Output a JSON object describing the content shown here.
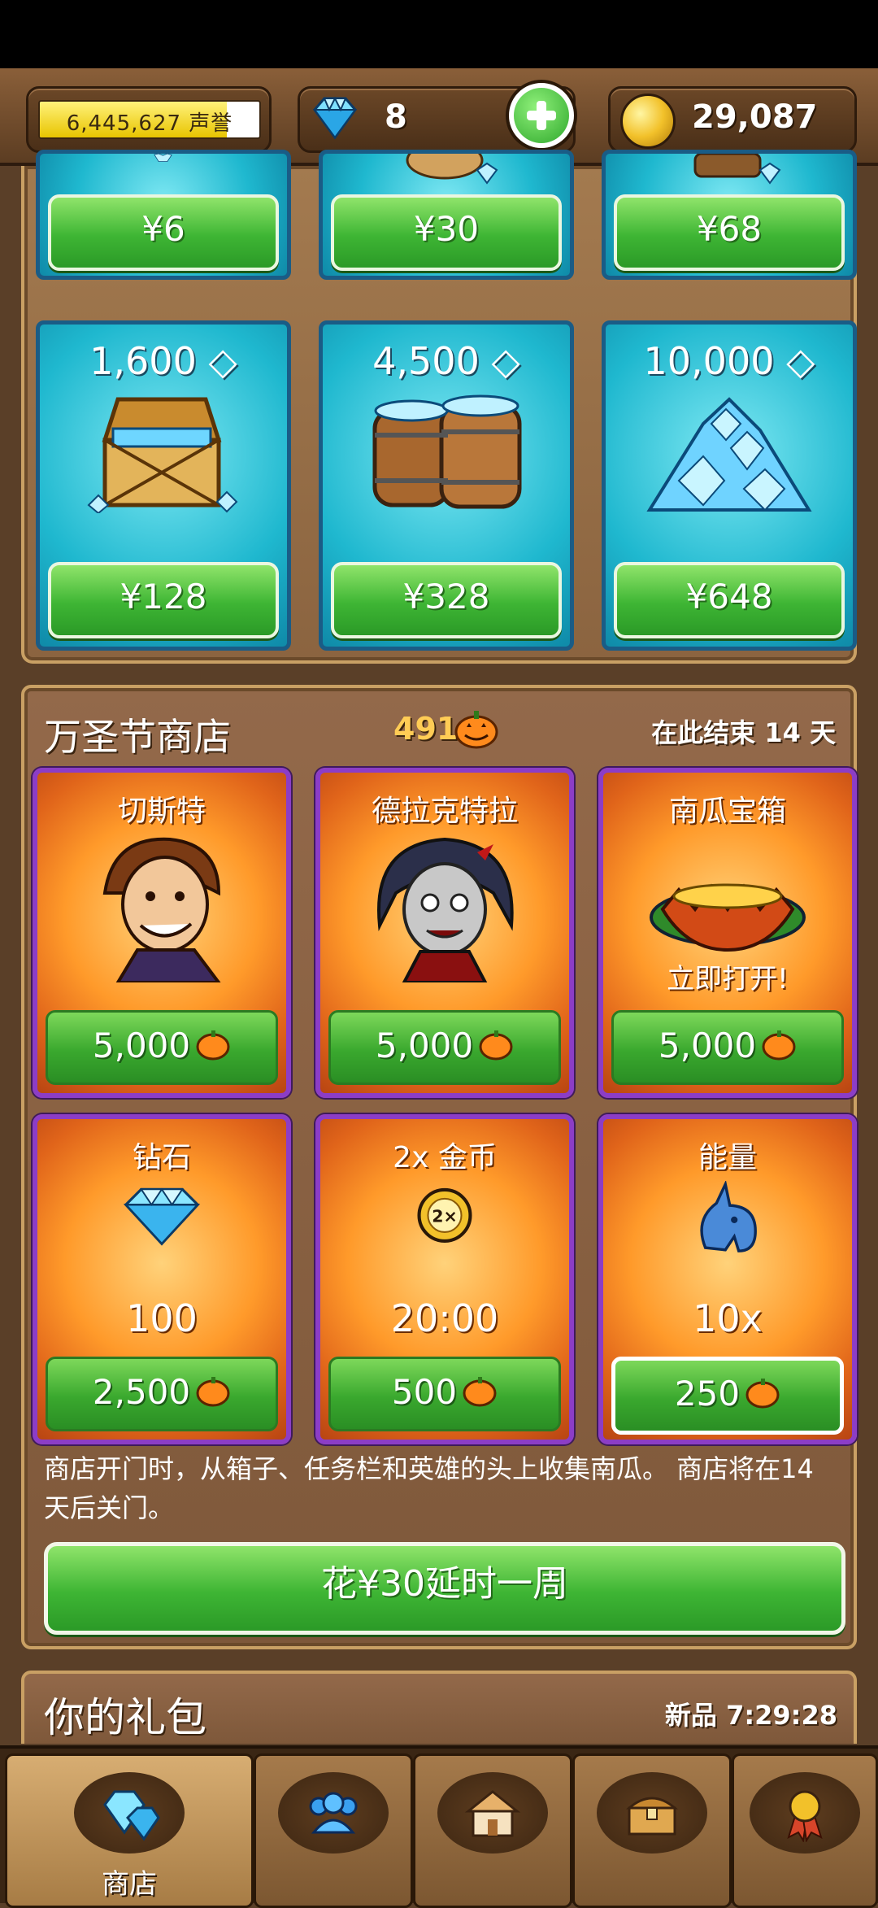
{
  "top_bar": {
    "reputation": "6,445,627 声誉",
    "reputation_fill": 0.85,
    "gems": "8",
    "coins": "29,087"
  },
  "gem_shop": {
    "top_row_prices": [
      "¥6",
      "¥30",
      "¥68"
    ],
    "packs": [
      {
        "amount": "1,600",
        "price": "¥128"
      },
      {
        "amount": "4,500",
        "price": "¥328"
      },
      {
        "amount": "10,000",
        "price": "¥648"
      }
    ]
  },
  "halloween": {
    "title": "万圣节商店",
    "pumpkins": "491",
    "ends": "在此结束 14 天",
    "items": [
      {
        "name": "切斯特",
        "sub": "",
        "price": "5,000"
      },
      {
        "name": "德拉克特拉",
        "sub": "",
        "price": "5,000"
      },
      {
        "name": "南瓜宝箱",
        "sub": "立即打开!",
        "price": "5,000"
      },
      {
        "name": "钻石",
        "sub": "100",
        "price": "2,500"
      },
      {
        "name": "2x 金币",
        "sub": "20:00",
        "price": "500"
      },
      {
        "name": "能量",
        "sub": "10x",
        "price": "250"
      }
    ],
    "description": "商店开门时，从箱子、任务栏和英雄的头上收集南瓜。 商店将在14 天后关门。",
    "extend_label": "花¥30延时一周"
  },
  "gifts": {
    "title": "你的礼包",
    "timer": "新品 7:29:28"
  },
  "nav": {
    "tabs": [
      {
        "label": "商店",
        "icon": "gems-icon"
      },
      {
        "label": "",
        "icon": "heroes-icon"
      },
      {
        "label": "",
        "icon": "town-icon"
      },
      {
        "label": "",
        "icon": "chest-icon"
      },
      {
        "label": "",
        "icon": "medal-icon"
      }
    ]
  },
  "colors": {
    "accent_green": "#3eb534",
    "halloween_border": "#8c3dc6",
    "gem_card": "#1fb8cf",
    "wood": "#7e583a"
  }
}
